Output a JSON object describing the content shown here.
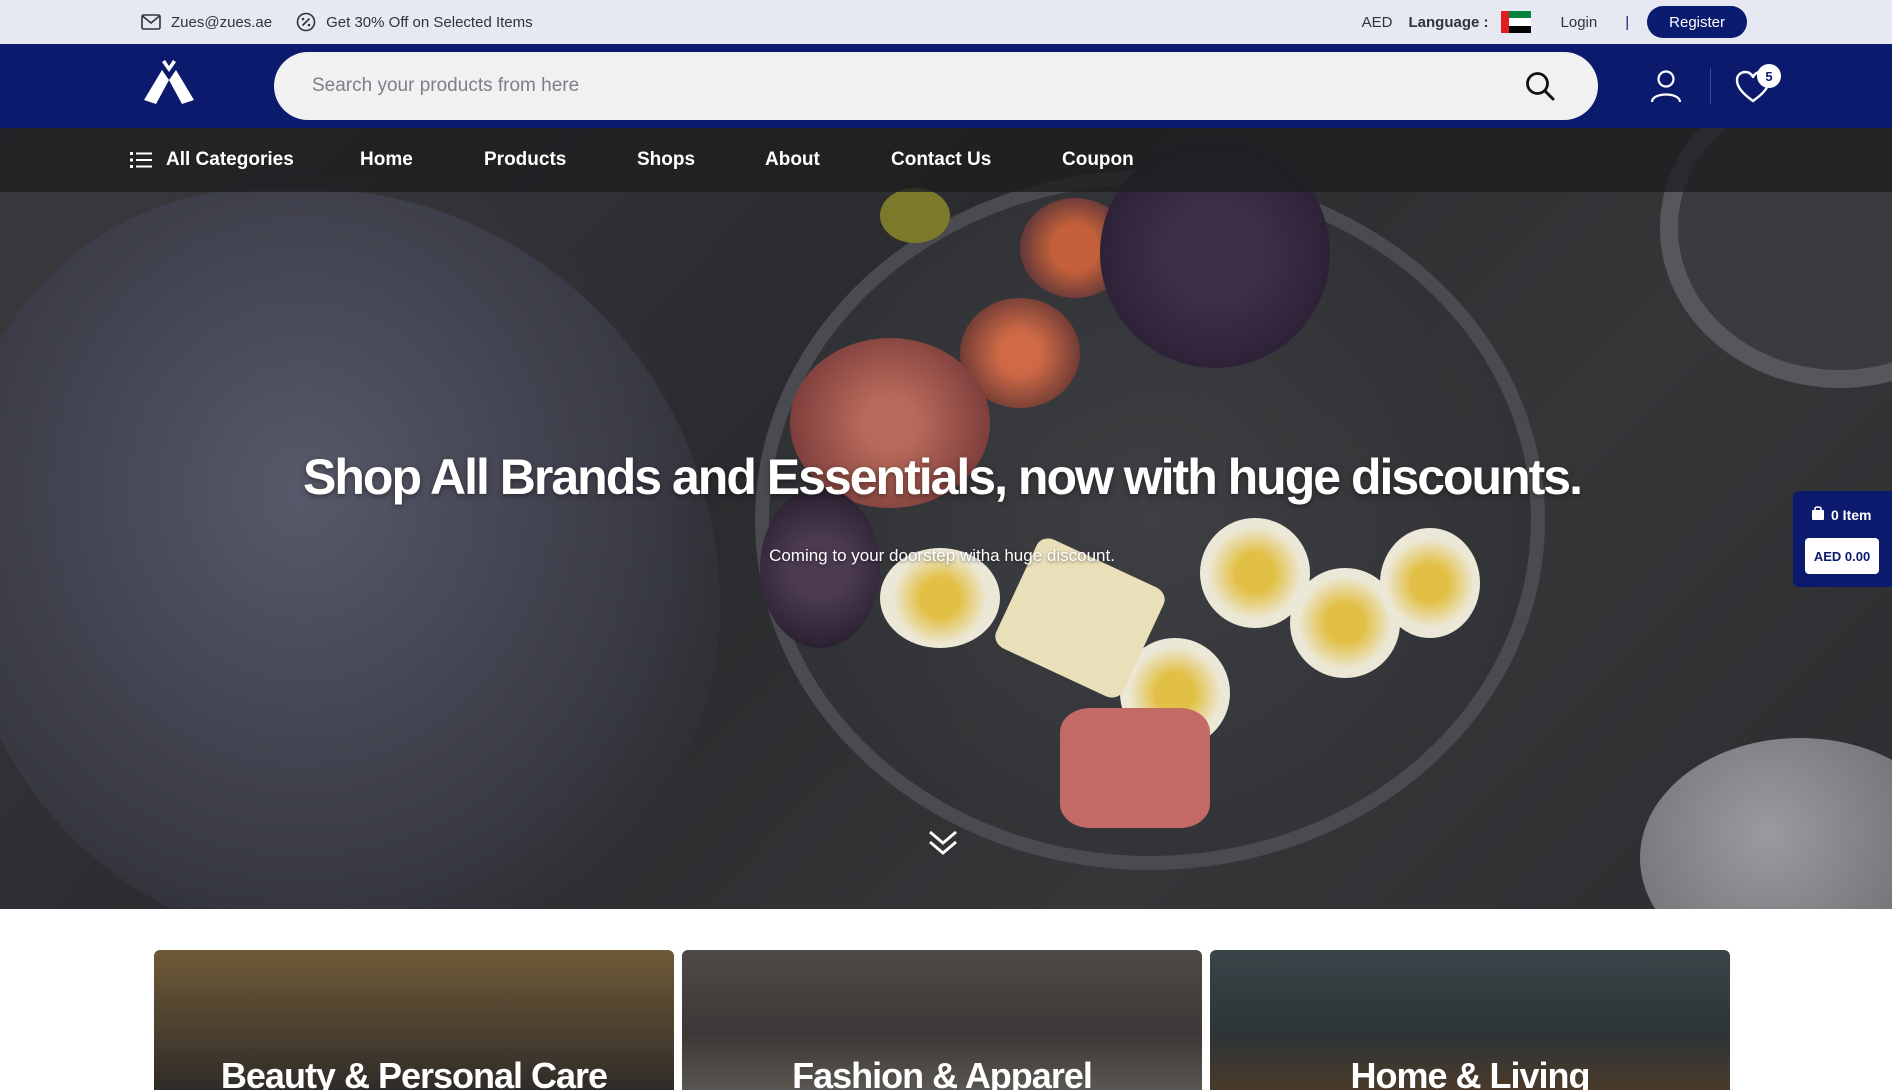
{
  "topbar": {
    "email": "Zues@zues.ae",
    "promo": "Get 30% Off on Selected Items",
    "currency": "AED",
    "language_label": "Language :",
    "login": "Login",
    "separator": "|",
    "register": "Register"
  },
  "header": {
    "search_placeholder": "Search your products from here",
    "wishlist_count": "5"
  },
  "nav": {
    "all_categories": "All Categories",
    "items": [
      "Home",
      "Products",
      "Shops",
      "About",
      "Contact Us",
      "Coupon"
    ]
  },
  "hero": {
    "title": "Shop All Brands and Essentials, now with huge discounts.",
    "subtitle": "Coming to your doorstep witha huge discount."
  },
  "cart": {
    "items": "0 Item",
    "total": "AED 0.00"
  },
  "categories": [
    {
      "label": "Beauty & Personal Care"
    },
    {
      "label": "Fashion & Apparel"
    },
    {
      "label": "Home & Living"
    }
  ],
  "colors": {
    "brand_navy": "#0c1a6e",
    "topbar_bg": "#e6e9f2",
    "search_bg": "#f1f1f2"
  }
}
